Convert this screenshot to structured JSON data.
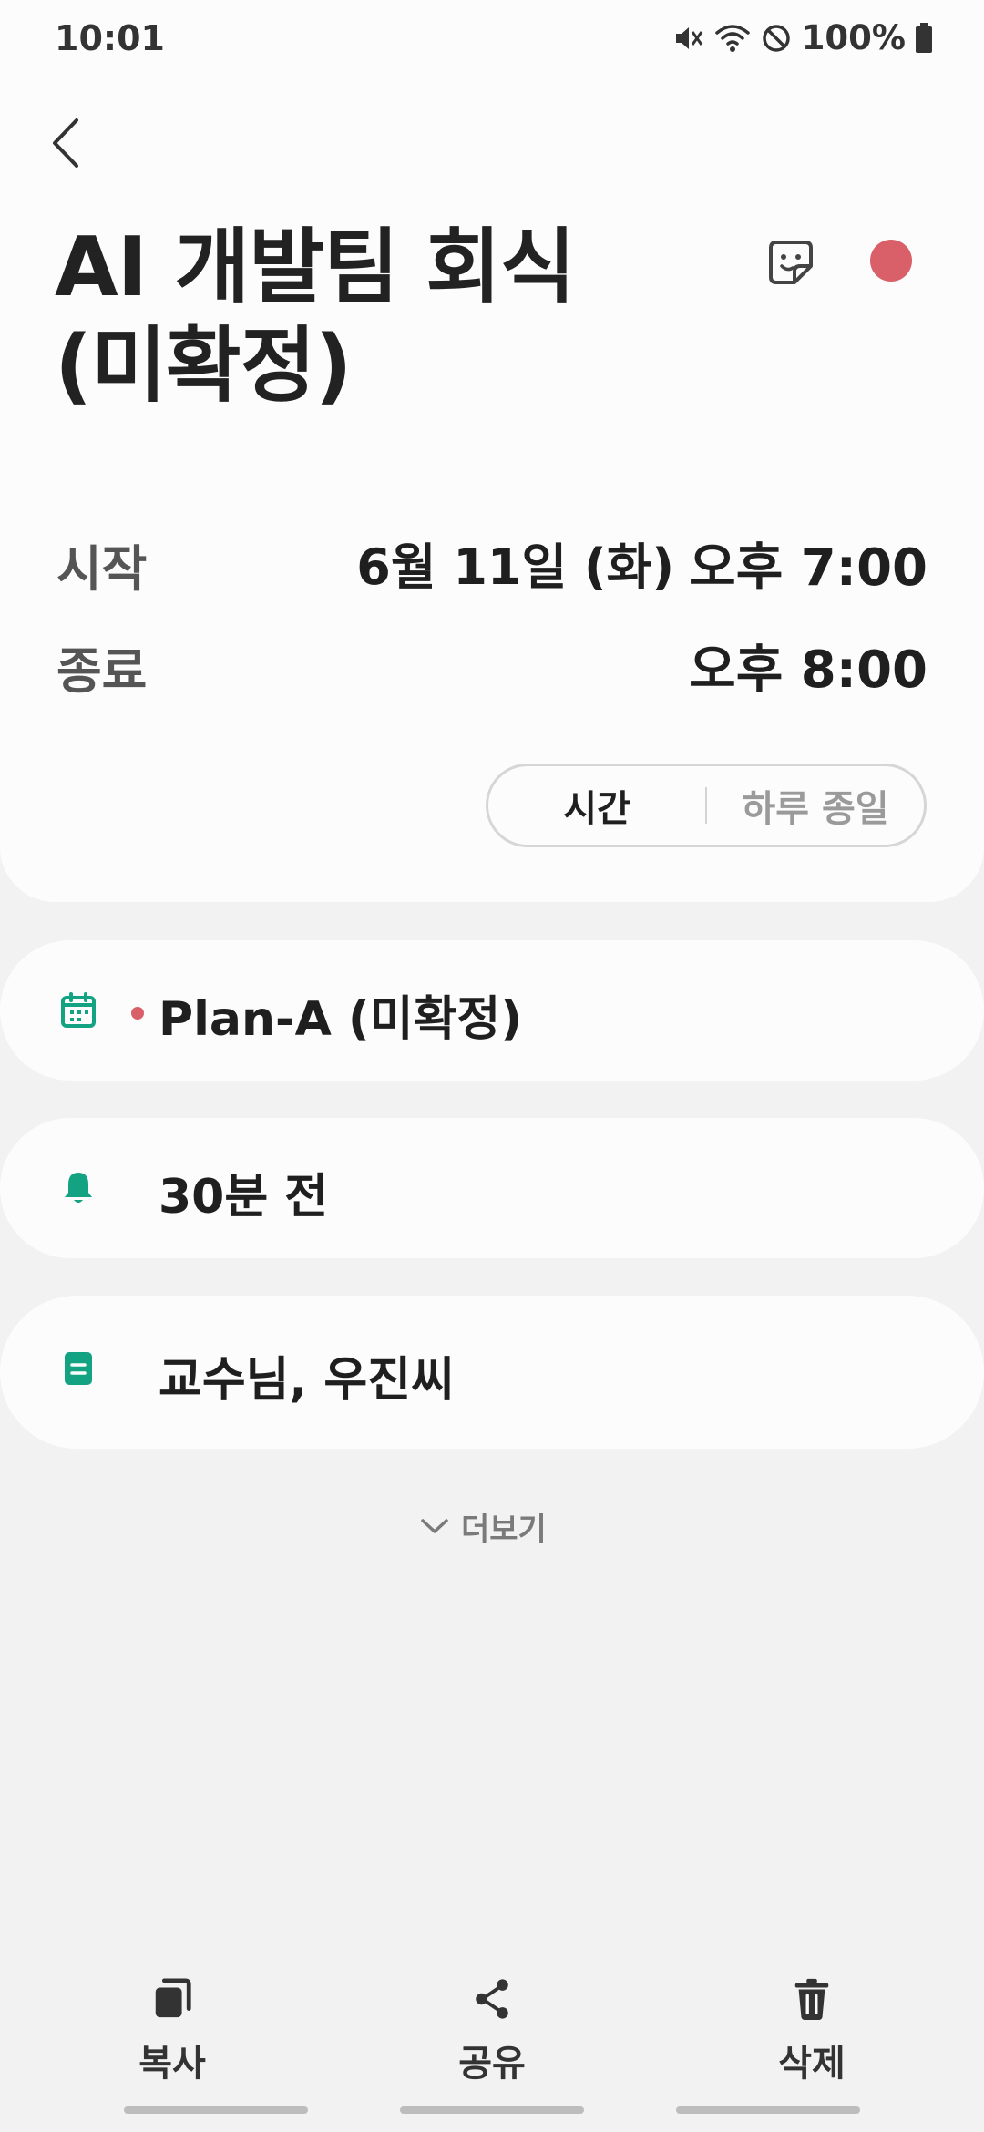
{
  "status_bar": {
    "time": "10:01",
    "battery": "100%",
    "icons": [
      "mute-icon",
      "wifi-icon",
      "do-not-disturb-icon",
      "battery-icon"
    ]
  },
  "event": {
    "title_line1": "AI 개발팀 회식",
    "title_line2": "(미확정)",
    "color": "#d95f68",
    "start_label": "시작",
    "start_date": "6월 11일 (화)",
    "start_time": "오후 7:00",
    "end_label": "종료",
    "end_time": "오후 8:00"
  },
  "toggle": {
    "options": [
      "시간",
      "하루 종일"
    ],
    "selected": "시간"
  },
  "details": {
    "calendar_name": "Plan-A (미확정)",
    "calendar_color": "#d95f68",
    "reminder": "30분 전",
    "memo": "교수님, 우진씨",
    "icon_color": "#13a383"
  },
  "more_label": "더보기",
  "actions": {
    "copy": "복사",
    "share": "공유",
    "delete": "삭제"
  }
}
